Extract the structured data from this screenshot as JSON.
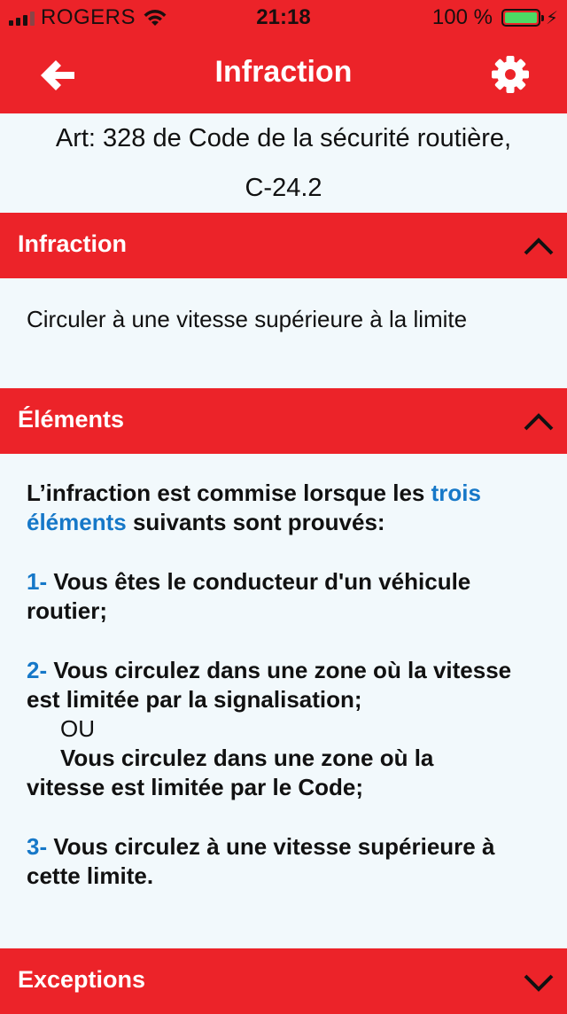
{
  "status_bar": {
    "carrier": "ROGERS",
    "time": "21:18",
    "battery_percent": "100 %",
    "signal_bars": 3
  },
  "nav": {
    "title": "Infraction",
    "back_icon": "back-arrow-icon",
    "settings_icon": "gear-icon"
  },
  "article": {
    "line1": "Art: 328 de Code de la sécurité routière,",
    "line2": "C-24.2"
  },
  "sections": {
    "infraction": {
      "label": "Infraction",
      "expanded": true,
      "text": "Circuler à une vitesse supérieure à la limite"
    },
    "elements": {
      "label": "Éléments",
      "expanded": true,
      "intro_before": "L’infraction est commise lorsque les ",
      "intro_link": "trois éléments",
      "intro_after": " suivants sont prouvés:",
      "items": [
        {
          "num": "1-",
          "text": " Vous êtes le conducteur d'un véhicule routier;"
        },
        {
          "num": "2-",
          "text": " Vous circulez dans une zone où la vitesse est limitée par la signalisation;"
        },
        {
          "num": "3-",
          "text": " Vous circulez à une vitesse supérieure à cette limite."
        }
      ],
      "or_text": "OU",
      "alt_text_line1": "Vous circulez dans une zone où la",
      "alt_text_line2": "vitesse est limitée par le Code;"
    },
    "exceptions": {
      "label": "Exceptions",
      "expanded": false
    }
  },
  "colors": {
    "brand_red": "#ec2329",
    "link_blue": "#1678c8",
    "background": "#f2f9fc"
  }
}
